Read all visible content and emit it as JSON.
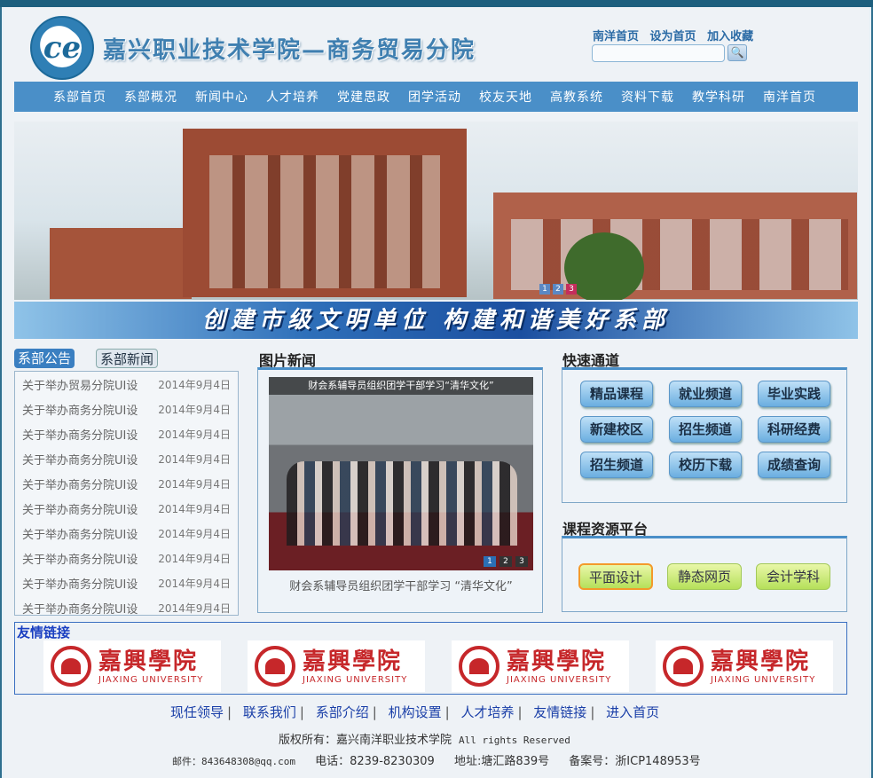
{
  "header": {
    "logo_text": "ce",
    "site_title": "嘉兴职业技术学院—商务贸易分院",
    "top_links": [
      "南洋首页",
      "设为首页",
      "加入收藏"
    ],
    "search": {
      "placeholder": "",
      "button_icon": "search-icon"
    }
  },
  "nav": {
    "items": [
      "系部首页",
      "系部概况",
      "新闻中心",
      "人才培养",
      "党建思政",
      "团学活动",
      "校友天地",
      "高教系统",
      "资料下载",
      "教学科研",
      "南洋首页"
    ]
  },
  "banner": {
    "slide_indicators": [
      "1",
      "2",
      "3"
    ],
    "active_slide": "3",
    "slogan": "创建市级文明单位  构建和谐美好系部"
  },
  "notices": {
    "tabs": [
      "系部公告",
      "系部新闻"
    ],
    "active_tab": "系部公告",
    "items": [
      {
        "title": "关于举办贸易分院UI设",
        "date": "2014年9月4日"
      },
      {
        "title": "关于举办商务分院UI设",
        "date": "2014年9月4日"
      },
      {
        "title": "关于举办商务分院UI设",
        "date": "2014年9月4日"
      },
      {
        "title": "关于举办商务分院UI设",
        "date": "2014年9月4日"
      },
      {
        "title": "关于举办商务分院UI设",
        "date": "2014年9月4日"
      },
      {
        "title": "关于举办商务分院UI设",
        "date": "2014年9月4日"
      },
      {
        "title": "关于举办商务分院UI设",
        "date": "2014年9月4日"
      },
      {
        "title": "关于举办商务分院UI设",
        "date": "2014年9月4日"
      },
      {
        "title": "关于举办商务分院UI设",
        "date": "2014年9月4日"
      },
      {
        "title": "关于举办商务分院UI设",
        "date": "2014年9月4日"
      }
    ]
  },
  "photo_news": {
    "title": "图片新闻",
    "overlay_caption": "财会系辅导员组织团学干部学习“清华文化”",
    "caption": "财会系辅导员组织团学干部学习 “清华文化”",
    "pager": [
      "1",
      "2",
      "3"
    ],
    "active_page": "1"
  },
  "quick_access": {
    "title": "快速通道",
    "buttons": [
      "精品课程",
      "就业频道",
      "毕业实践",
      "新建校区",
      "招生频道",
      "科研经费",
      "招生频道",
      "校历下载",
      "成绩查询"
    ]
  },
  "course_platform": {
    "title": "课程资源平台",
    "buttons": [
      "平面设计",
      "静态网页",
      "会计学科"
    ],
    "active": "平面设计"
  },
  "friend_links": {
    "title": "友情链接",
    "logos": [
      {
        "cn": "嘉興學院",
        "en": "JIAXING UNIVERSITY"
      },
      {
        "cn": "嘉興學院",
        "en": "JIAXING UNIVERSITY"
      },
      {
        "cn": "嘉興學院",
        "en": "JIAXING UNIVERSITY"
      },
      {
        "cn": "嘉興學院",
        "en": "JIAXING UNIVERSITY"
      }
    ]
  },
  "footer": {
    "links": [
      "现任领导",
      "联系我们",
      "系部介绍",
      "机构设置",
      "人才培养",
      "友情链接",
      "进入首页"
    ],
    "copyright_cn": "版权所有：嘉兴南洋职业技术学院",
    "copyright_en": "All rights Reserved",
    "email": "邮件：843648308@qq.com",
    "phone": "电话：8239-8230309",
    "address": "地址:塘汇路839号",
    "icp": "备案号：浙ICP148953号"
  },
  "colors": {
    "nav_bg": "#4a8fc8",
    "active_slide_dot": "#c42d5c",
    "link_blue": "#1a3fa8",
    "brand_red": "#c6272a"
  }
}
